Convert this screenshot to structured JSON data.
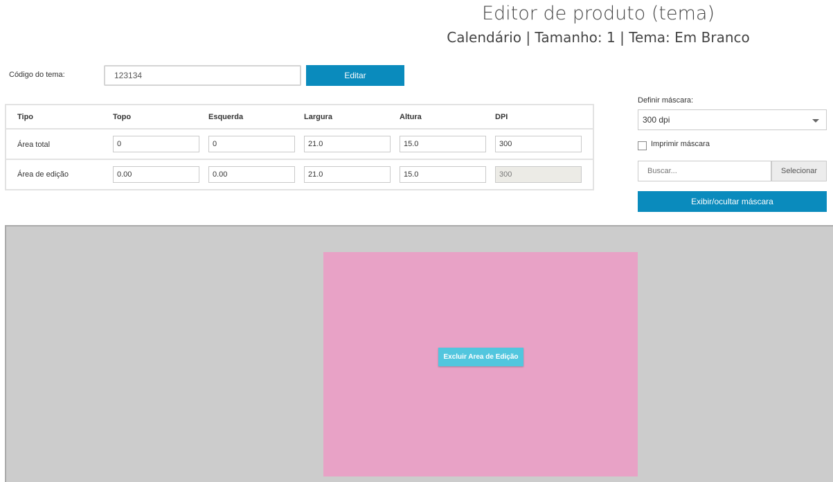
{
  "header": {
    "title": "Editor de produto (tema)",
    "subtitle": "Calendário | Tamanho: 1 | Tema: Em Branco"
  },
  "theme_code": {
    "label": "Código do tema:",
    "value": "123134",
    "edit_label": "Editar"
  },
  "table": {
    "headers": [
      "Tipo",
      "Topo",
      "Esquerda",
      "Largura",
      "Altura",
      "DPI"
    ],
    "rows": [
      {
        "label": "Área total",
        "values": [
          "0",
          "0",
          "21.0",
          "15.0",
          "300"
        ]
      },
      {
        "label": "Área de edição",
        "values": [
          "0.00",
          "0.00",
          "21.0",
          "15.0",
          "300"
        ]
      }
    ]
  },
  "mask": {
    "label": "Definir máscara:",
    "selected": "300 dpi",
    "print_label": "Imprimir máscara",
    "print_checked": false,
    "search_placeholder": "Buscar...",
    "select_label": "Selecionar",
    "toggle_label": "Exibir/ocultar máscara"
  },
  "canvas": {
    "delete_label": "Excluir Area de Edição",
    "background_color": "#cccccc",
    "area_color": "#e8a2c6",
    "accent_color": "#0a8bbd",
    "delete_color": "#52c6de"
  }
}
